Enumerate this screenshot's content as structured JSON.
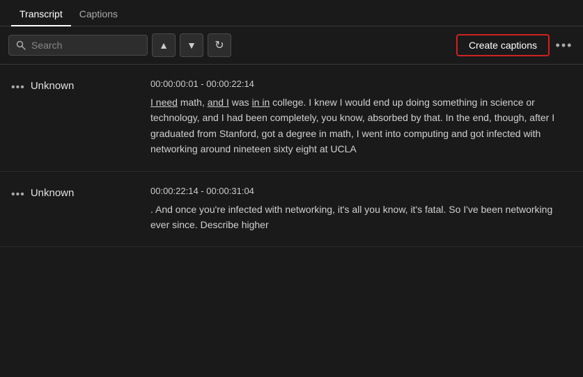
{
  "tabs": [
    {
      "label": "Transcript",
      "active": true
    },
    {
      "label": "Captions",
      "active": false
    }
  ],
  "toolbar": {
    "search_placeholder": "Search",
    "up_icon": "▲",
    "down_icon": "▼",
    "refresh_icon": "↻",
    "create_captions_label": "Create captions",
    "more_icon": "•••"
  },
  "transcript_entries": [
    {
      "speaker": "Unknown",
      "timestamp": "00:00:00:01 - 00:00:22:14",
      "text_parts": [
        {
          "text": "I need",
          "underline": true
        },
        {
          "text": " math, ",
          "underline": false
        },
        {
          "text": "and I",
          "underline": true
        },
        {
          "text": " was ",
          "underline": false
        },
        {
          "text": "in in",
          "underline": true
        },
        {
          "text": " college. I knew I would end up doing something in science or technology, and I had been completely, you know, absorbed by that. In the end, though, after I graduated from Stanford, got a degree in math, I went into computing and got infected with networking around nineteen sixty eight at UCLA",
          "underline": false
        }
      ]
    },
    {
      "speaker": "Unknown",
      "timestamp": "00:00:22:14 - 00:00:31:04",
      "text_parts": [
        {
          "text": ". And once you're infected with networking, it's all you know, it's fatal. So I've been networking ever since. Describe higher",
          "underline": false
        }
      ]
    }
  ]
}
